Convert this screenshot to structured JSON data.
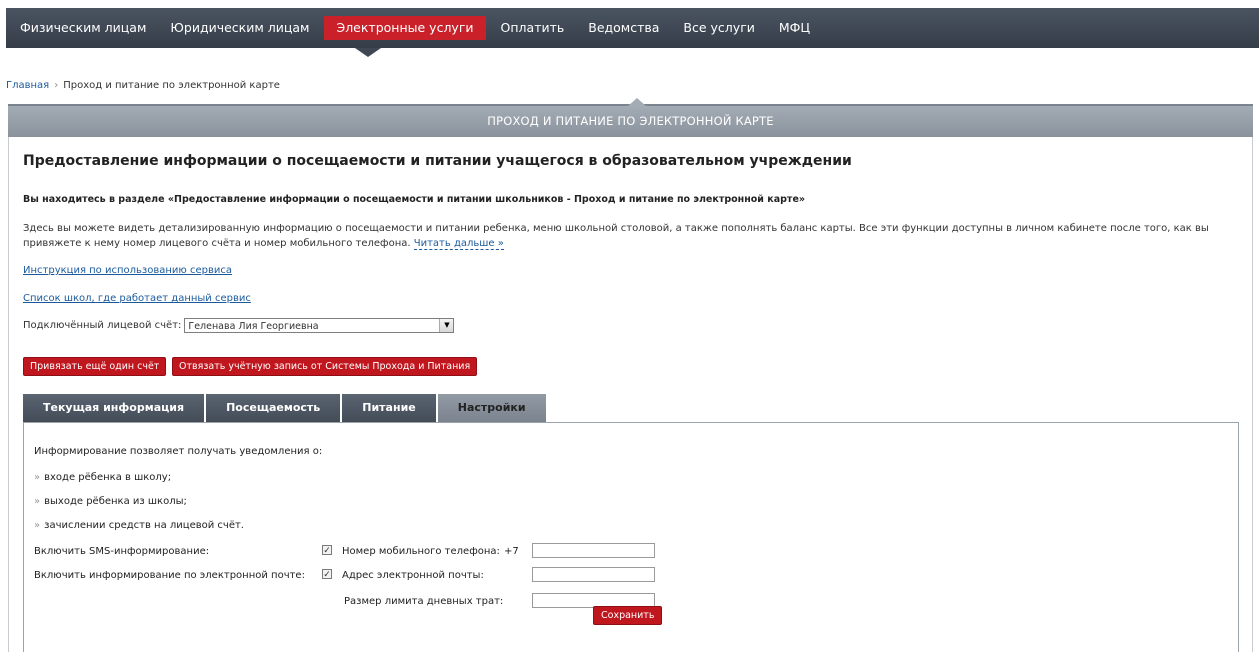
{
  "nav": {
    "items": [
      {
        "label": "Физическим лицам",
        "active": false
      },
      {
        "label": "Юридическим лицам",
        "active": false
      },
      {
        "label": "Электронные услуги",
        "active": true
      },
      {
        "label": "Оплатить",
        "active": false
      },
      {
        "label": "Ведомства",
        "active": false
      },
      {
        "label": "Все услуги",
        "active": false
      },
      {
        "label": "МФЦ",
        "active": false
      }
    ]
  },
  "breadcrumb": {
    "home": "Главная",
    "separator": "›",
    "current": "Проход и питание по электронной карте"
  },
  "section": {
    "title": "ПРОХОД И ПИТАНИЕ ПО ЭЛЕКТРОННОЙ КАРТЕ"
  },
  "page": {
    "title": "Предоставление информации о посещаемости и питании учащегося в образовательном учреждении",
    "you_are_here": "Вы находитесь в разделе «Предоставление информации о посещаемости и питании школьников - Проход и питание по электронной карте»",
    "description": "Здесь вы можете видеть детализированную информацию о посещаемости и питании ребенка, меню школьной столовой, а также пополнять баланс карты. Все эти функции доступны в личном кабинете после того, как вы привяжете к нему номер лицевого счёта и номер мобильного телефона.",
    "read_more": "Читать дальше »",
    "instruction_link": "Инструкция по использованию сервиса",
    "schools_link": "Список школ, где работает данный сервис",
    "account_label": "Подключённый лицевой счёт:",
    "account_value": "Геленава Лия Георгиевна",
    "bind_button": "Привязать ещё один счёт",
    "unbind_button": "Отвязать учётную запись от Системы Прохода и Питания"
  },
  "tabs": [
    {
      "label": "Текущая информация",
      "active": false
    },
    {
      "label": "Посещаемость",
      "active": false
    },
    {
      "label": "Питание",
      "active": false
    },
    {
      "label": "Настройки",
      "active": true
    }
  ],
  "settings": {
    "intro": "Информирование позволяет получать уведомления о:",
    "bullets": [
      "входе рёбенка в школу;",
      "выходе рёбенка из школы;",
      "зачислении средств на лицевой счёт."
    ],
    "bullet_mark": "»",
    "sms_label": "Включить SMS-информирование:",
    "sms_checked": true,
    "phone_label": "Номер мобильного телефона:",
    "phone_prefix": "+7",
    "phone_value": "",
    "email_toggle_label": "Включить информирование по электронной почте:",
    "email_checked": true,
    "email_label": "Адрес электронной почты:",
    "email_value": "",
    "limit_label": "Размер лимита дневных трат:",
    "limit_value": "",
    "save_button": "Сохранить",
    "check_mark": "✓"
  }
}
